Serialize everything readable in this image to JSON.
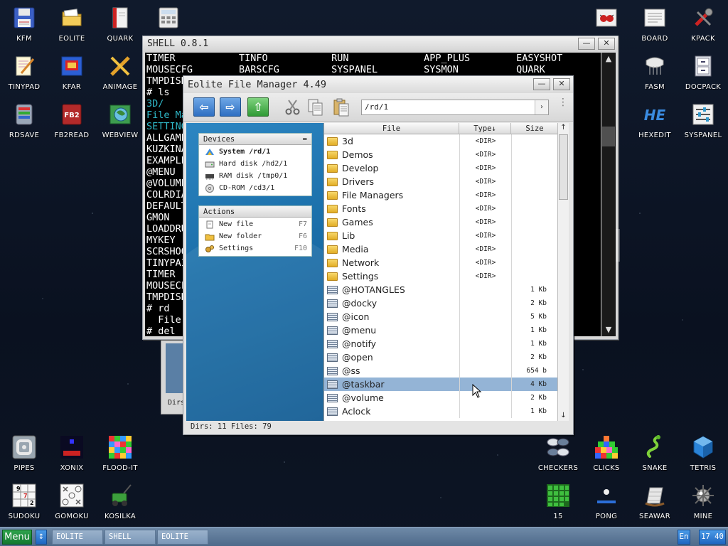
{
  "desktop": {
    "icons_left": [
      {
        "label": "KFM",
        "icon": "floppy-icon"
      },
      {
        "label": "EOLITE",
        "icon": "folder-icon"
      },
      {
        "label": "QUARK",
        "icon": "book-icon"
      },
      {
        "label": "",
        "icon": "calculator-icon"
      },
      {
        "label": "TINYPAD",
        "icon": "notepad-icon"
      },
      {
        "label": "KFAR",
        "icon": "archive-icon"
      },
      {
        "label": "ANIMAGE",
        "icon": "paint-icon"
      },
      {
        "label": "RDSAVE",
        "icon": "save-disk-icon"
      },
      {
        "label": "FB2READ",
        "icon": "ebook-icon"
      },
      {
        "label": "WEBVIEW",
        "icon": "globe-icon"
      }
    ],
    "icons_right": [
      {
        "label": "",
        "icon": "bug-icon"
      },
      {
        "label": "BOARD",
        "icon": "board-icon"
      },
      {
        "label": "KPACK",
        "icon": "tools-icon"
      },
      {
        "label": "FASM",
        "icon": "chip-icon"
      },
      {
        "label": "DOCPACK",
        "icon": "cabinet-icon"
      },
      {
        "label": "HEXEDIT",
        "icon": "hex-icon"
      },
      {
        "label": "SYSPANEL",
        "icon": "sliders-icon"
      }
    ],
    "icons_bottom_left": [
      {
        "label": "PIPES",
        "icon": "pipes-icon"
      },
      {
        "label": "XONIX",
        "icon": "xonix-icon"
      },
      {
        "label": "FLOOD-IT",
        "icon": "flood-icon"
      },
      {
        "label": "SUDOKU",
        "icon": "sudoku-icon"
      },
      {
        "label": "GOMOKU",
        "icon": "gomoku-icon"
      },
      {
        "label": "KOSILKA",
        "icon": "mower-icon"
      }
    ],
    "icons_bottom_right": [
      {
        "label": "CHECKERS",
        "icon": "checkers-icon"
      },
      {
        "label": "CLICKS",
        "icon": "clicks-icon"
      },
      {
        "label": "SNAKE",
        "icon": "snake-icon"
      },
      {
        "label": "TETRIS",
        "icon": "tetris-icon"
      },
      {
        "label": "15",
        "icon": "fifteen-icon"
      },
      {
        "label": "PONG",
        "icon": "pong-icon"
      },
      {
        "label": "SEAWAR",
        "icon": "seawar-icon"
      },
      {
        "label": "MINE",
        "icon": "mine-icon"
      }
    ],
    "hexedit_glyph": "HE",
    "fb2_glyph": "FB2"
  },
  "shell": {
    "title": "SHELL 0.8.1",
    "min": "—",
    "close": "✕",
    "lines": [
      {
        "text": "TIMER           TINFO           RUN             APP_PLUS        EASYSHOT",
        "cls": ""
      },
      {
        "text": "MOUSECFG        BARSCFG         SYSPANEL        SYSMON          QUARK",
        "cls": ""
      },
      {
        "text": "TMPDISK",
        "cls": ""
      },
      {
        "text": "# ls",
        "cls": ""
      },
      {
        "text": "3D/",
        "cls": "cyan"
      },
      {
        "text": "File Ma",
        "cls": "cyan"
      },
      {
        "text": "SETTING",
        "cls": "cyan"
      },
      {
        "text": "ALLGAME",
        "cls": ""
      },
      {
        "text": "KUZKINA",
        "cls": ""
      },
      {
        "text": "EXAMPLE",
        "cls": ""
      },
      {
        "text": "@MENU",
        "cls": ""
      },
      {
        "text": "@VOLUME",
        "cls": ""
      },
      {
        "text": "COLRDIA",
        "cls": ""
      },
      {
        "text": "DEFAULT",
        "cls": ""
      },
      {
        "text": "GMON",
        "cls": ""
      },
      {
        "text": "LOADDRU",
        "cls": ""
      },
      {
        "text": "MYKEY",
        "cls": ""
      },
      {
        "text": "SCRSHOO",
        "cls": ""
      },
      {
        "text": "TINYPAI",
        "cls": ""
      },
      {
        "text": "TIMER",
        "cls": ""
      },
      {
        "text": "MOUSECF",
        "cls": ""
      },
      {
        "text": "TMPDISK",
        "cls": ""
      },
      {
        "text": "# rd",
        "cls": ""
      },
      {
        "text": "  File ",
        "cls": ""
      },
      {
        "text": "# del",
        "cls": ""
      }
    ],
    "scroll_up": "▲",
    "scroll_down": "▼"
  },
  "ghost_window": {
    "text": "Dirs"
  },
  "fm": {
    "title": "Eolite File Manager 4.49",
    "min": "—",
    "close": "✕",
    "toolbar": {
      "back": "⇦",
      "forward": "⇨",
      "up": "⇧"
    },
    "path": "/rd/1",
    "go": "›",
    "kebab": "⋮",
    "devices": {
      "header": "Devices",
      "header_eq": "=",
      "items": [
        {
          "label": "System /rd/1",
          "icon": "system-icon",
          "bold": true
        },
        {
          "label": "Hard disk /hd2/1",
          "icon": "harddisk-icon",
          "bold": false
        },
        {
          "label": "RAM disk /tmp0/1",
          "icon": "ramdisk-icon",
          "bold": false
        },
        {
          "label": "CD-ROM /cd3/1",
          "icon": "cdrom-icon",
          "bold": false
        }
      ]
    },
    "actions": {
      "header": "Actions",
      "items": [
        {
          "label": "New file",
          "key": "F7",
          "icon": "new-file-icon"
        },
        {
          "label": "New folder",
          "key": "F6",
          "icon": "new-folder-icon"
        },
        {
          "label": "Settings",
          "key": "F10",
          "icon": "settings-icon"
        }
      ]
    },
    "columns": {
      "name": "File",
      "type": "Type↓",
      "size": "Size",
      "up": "↑"
    },
    "files": [
      {
        "name": "3d",
        "type": "<DIR>",
        "size": "",
        "kind": "folder"
      },
      {
        "name": "Demos",
        "type": "<DIR>",
        "size": "",
        "kind": "folder"
      },
      {
        "name": "Develop",
        "type": "<DIR>",
        "size": "",
        "kind": "folder"
      },
      {
        "name": "Drivers",
        "type": "<DIR>",
        "size": "",
        "kind": "folder"
      },
      {
        "name": "File Managers",
        "type": "<DIR>",
        "size": "",
        "kind": "folder"
      },
      {
        "name": "Fonts",
        "type": "<DIR>",
        "size": "",
        "kind": "folder"
      },
      {
        "name": "Games",
        "type": "<DIR>",
        "size": "",
        "kind": "folder"
      },
      {
        "name": "Lib",
        "type": "<DIR>",
        "size": "",
        "kind": "folder"
      },
      {
        "name": "Media",
        "type": "<DIR>",
        "size": "",
        "kind": "folder"
      },
      {
        "name": "Network",
        "type": "<DIR>",
        "size": "",
        "kind": "folder"
      },
      {
        "name": "Settings",
        "type": "<DIR>",
        "size": "",
        "kind": "folder"
      },
      {
        "name": "@HOTANGLES",
        "type": "",
        "size": "1 Kb",
        "kind": "file"
      },
      {
        "name": "@docky",
        "type": "",
        "size": "2 Kb",
        "kind": "file"
      },
      {
        "name": "@icon",
        "type": "",
        "size": "5 Kb",
        "kind": "file"
      },
      {
        "name": "@menu",
        "type": "",
        "size": "1 Kb",
        "kind": "file"
      },
      {
        "name": "@notify",
        "type": "",
        "size": "1 Kb",
        "kind": "file"
      },
      {
        "name": "@open",
        "type": "",
        "size": "2 Kb",
        "kind": "file"
      },
      {
        "name": "@ss",
        "type": "",
        "size": "654 b",
        "kind": "file"
      },
      {
        "name": "@taskbar",
        "type": "",
        "size": "4 Kb",
        "kind": "file",
        "selected": true
      },
      {
        "name": "@volume",
        "type": "",
        "size": "2 Kb",
        "kind": "file"
      },
      {
        "name": "Aclock",
        "type": "",
        "size": "1 Kb",
        "kind": "file"
      }
    ],
    "scroll_up": "↑",
    "scroll_down": "↓",
    "status": "Dirs: 11  Files: 79"
  },
  "taskbar": {
    "menu": "Menu",
    "swap": "↕",
    "tasks": [
      "EOLITE",
      "SHELL",
      "EOLITE"
    ],
    "lang": "En",
    "clock": "17 40"
  }
}
